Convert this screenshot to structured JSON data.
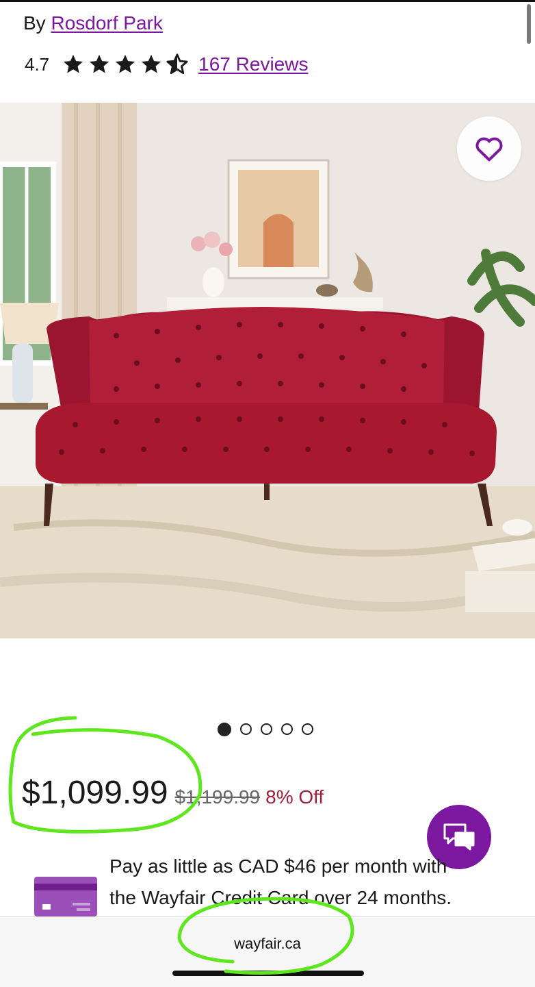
{
  "brand": {
    "prefix": "By",
    "name": "Rosdorf Park"
  },
  "rating": {
    "value": "4.7",
    "stars": 4.5,
    "max_stars": 5,
    "reviews_label": "167 Reviews"
  },
  "gallery": {
    "image_count": 5,
    "active_index": 0,
    "favorite_icon": "heart-outline-icon"
  },
  "price": {
    "current": "$1,099.99",
    "original": "$1,199.99",
    "discount": "8% Off"
  },
  "chat": {
    "icon": "chat-bubbles-icon"
  },
  "financing": {
    "line1": "Pay as little as CAD $46 per month with",
    "line2": "the Wayfair Credit Card over 24 months.",
    "icon": "credit-card-icon"
  },
  "browser": {
    "url": "wayfair.ca"
  },
  "colors": {
    "accent": "#7b189f",
    "discount": "#a0203a",
    "annotation": "#5ee61e"
  }
}
